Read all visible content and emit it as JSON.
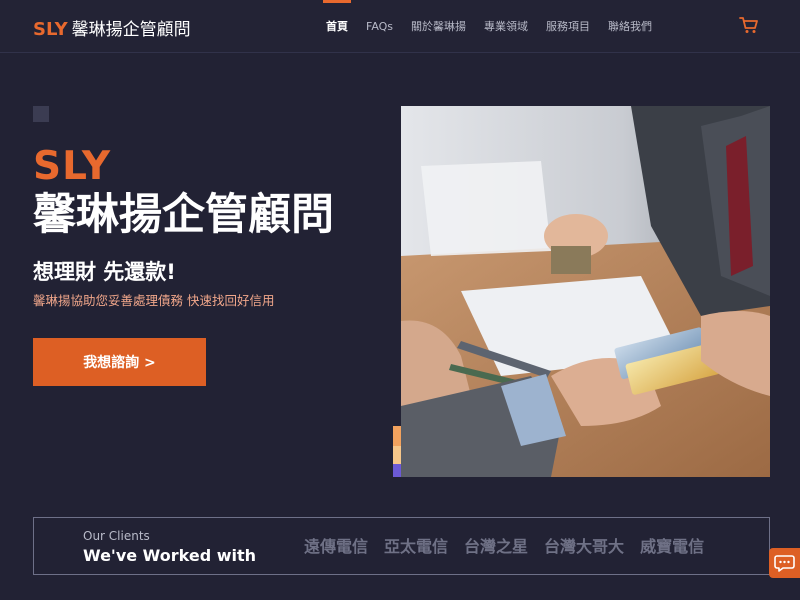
{
  "header": {
    "logo_mark": "SLY",
    "logo_name": "馨琳揚企管顧問",
    "nav": [
      {
        "label": "首頁",
        "active": true
      },
      {
        "label": "FAQs",
        "active": false
      },
      {
        "label": "關於馨琳揚",
        "active": false
      },
      {
        "label": "專業領域",
        "active": false
      },
      {
        "label": "服務項目",
        "active": false
      },
      {
        "label": "聯絡我們",
        "active": false
      }
    ],
    "cart_icon": "shopping-cart-icon"
  },
  "hero": {
    "brand": "SLY",
    "title": "馨琳揚企管顧問",
    "subtitle": "想理財 先還款!",
    "tagline": "馨琳揚協助您妥善處理債務 快速找回好信用",
    "cta_label": "我想諮詢 >",
    "photo_icon": "business-handshake-credit-card-photo"
  },
  "clients": {
    "kicker": "Our Clients",
    "heading": "We've Worked with",
    "logos": [
      "遠傳電信",
      "亞太電信",
      "台灣之星",
      "台灣大哥大",
      "威寶電信"
    ]
  },
  "chat": {
    "icon": "chat-bubble-icon"
  },
  "colors": {
    "background": "#222234",
    "accent": "#e8692e",
    "button": "#dd5f24",
    "muted_text": "#b8bac8",
    "tagline": "#f0a68a"
  }
}
